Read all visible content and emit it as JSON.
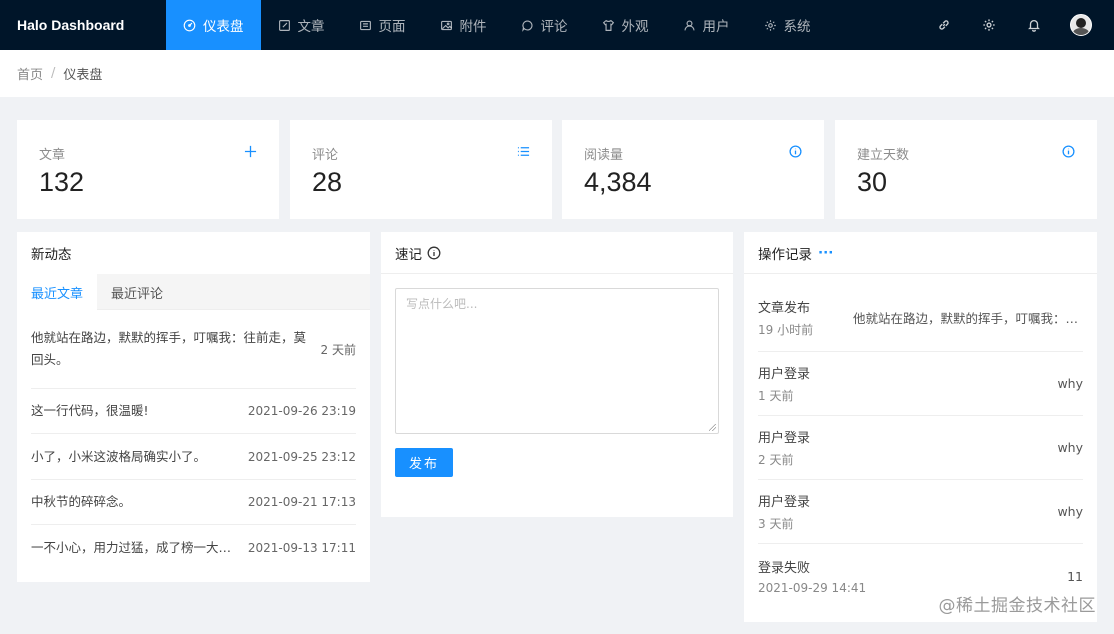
{
  "nav": {
    "brand": "Halo  Dashboard",
    "items": [
      {
        "label": "仪表盘",
        "icon": "dashboard-icon",
        "active": true
      },
      {
        "label": "文章",
        "icon": "edit-icon"
      },
      {
        "label": "页面",
        "icon": "page-icon"
      },
      {
        "label": "附件",
        "icon": "picture-icon"
      },
      {
        "label": "评论",
        "icon": "comment-icon"
      },
      {
        "label": "外观",
        "icon": "skin-icon"
      },
      {
        "label": "用户",
        "icon": "user-icon"
      },
      {
        "label": "系统",
        "icon": "setting-icon"
      }
    ],
    "right_icons": [
      "link-icon",
      "gear-icon",
      "bell-icon"
    ],
    "accent": "#1890ff",
    "background": "#001529"
  },
  "breadcrumb": {
    "home": "首页",
    "separator": "/",
    "current": "仪表盘"
  },
  "stats": [
    {
      "label": "文章",
      "value": "132",
      "icon": "plus-icon"
    },
    {
      "label": "评论",
      "value": "28",
      "icon": "list-icon"
    },
    {
      "label": "阅读量",
      "value": "4,384",
      "icon": "info-icon"
    },
    {
      "label": "建立天数",
      "value": "30",
      "icon": "info-icon"
    }
  ],
  "activity": {
    "title": "新动态",
    "tabs": [
      "最近文章",
      "最近评论"
    ],
    "items": [
      {
        "title": "他就站在路边，默默的挥手，叮嘱我：往前走，莫回头。",
        "time": "2 天前"
      },
      {
        "title": "这一行代码，很温暖!",
        "time": "2021-09-26 23:19"
      },
      {
        "title": "小了，小米这波格局确实小了。",
        "time": "2021-09-25 23:12"
      },
      {
        "title": "中秋节的碎碎念。",
        "time": "2021-09-21 17:13"
      },
      {
        "title": "一不小心，用力过猛，成了榜一大哥...",
        "time": "2021-09-13 17:11"
      }
    ]
  },
  "memo": {
    "title": "速记",
    "placeholder": "写点什么吧...",
    "button": "发布"
  },
  "logs": {
    "title": "操作记录",
    "more": "···",
    "items": [
      {
        "action": "文章发布",
        "time": "19 小时前",
        "detail": "他就站在路边，默默的挥手，叮嘱我：往前走，莫回头。"
      },
      {
        "action": "用户登录",
        "time": "1 天前",
        "detail": "why"
      },
      {
        "action": "用户登录",
        "time": "2 天前",
        "detail": "why"
      },
      {
        "action": "用户登录",
        "time": "3 天前",
        "detail": "why"
      },
      {
        "action": "登录失败",
        "time": "2021-09-29 14:41",
        "detail": "11"
      }
    ]
  },
  "watermark": "@稀土掘金技术社区"
}
